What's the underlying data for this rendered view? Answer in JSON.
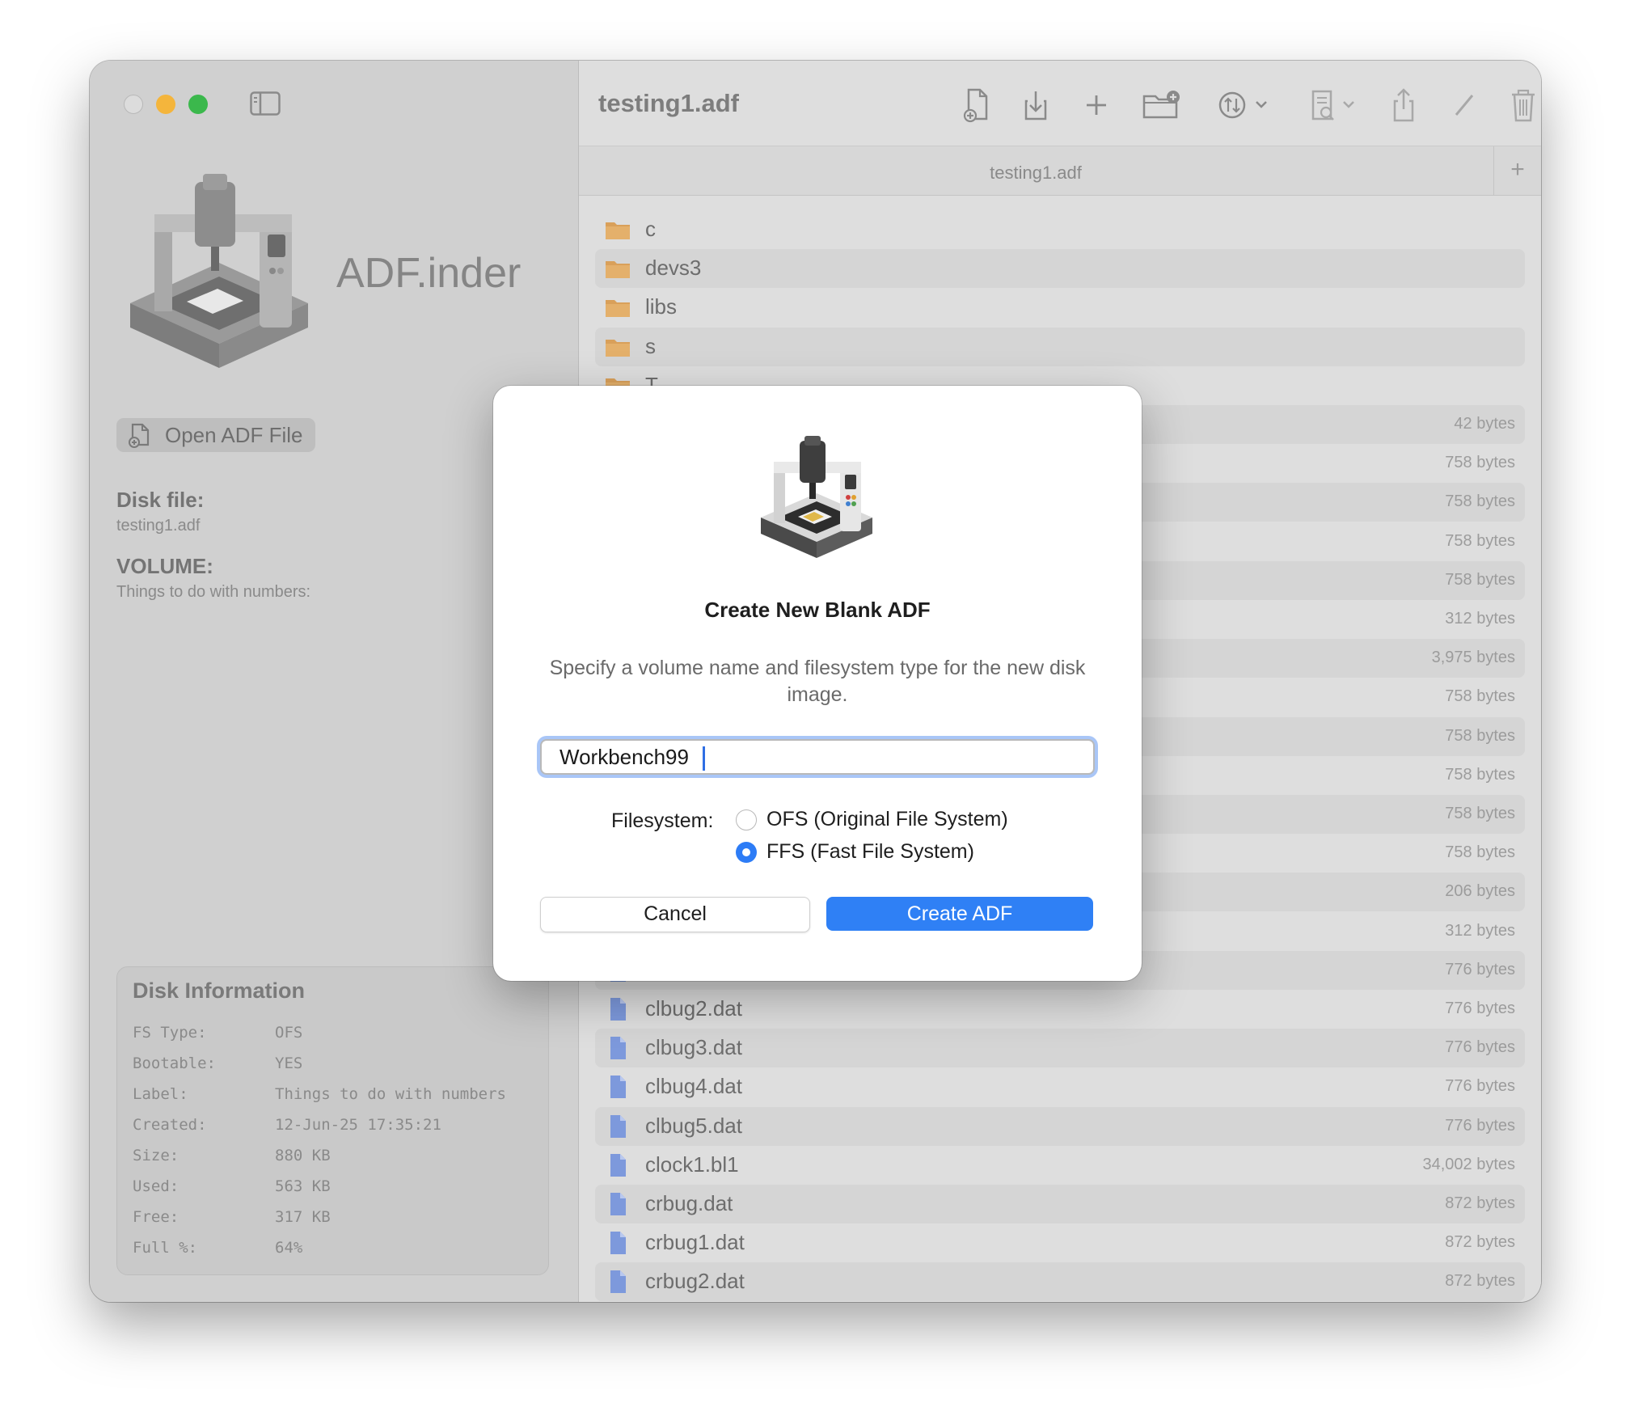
{
  "window": {
    "title": "testing1.adf"
  },
  "sidebar": {
    "app_name": "ADF.inder",
    "open_button": "Open ADF File",
    "disk_file_heading": "Disk file:",
    "disk_file_value": "testing1.adf",
    "volume_heading": "VOLUME:",
    "volume_value": "Things to do with numbers:",
    "disk_info": {
      "title": "Disk Information",
      "rows": [
        {
          "key": "FS Type:",
          "value": "OFS"
        },
        {
          "key": "Bootable:",
          "value": "YES"
        },
        {
          "key": "Label:",
          "value": "Things to do with numbers"
        },
        {
          "key": "Created:",
          "value": "12-Jun-25 17:35:21"
        },
        {
          "key": "Size:",
          "value": "880 KB"
        },
        {
          "key": "Used:",
          "value": "563 KB"
        },
        {
          "key": "Free:",
          "value": "317 KB"
        },
        {
          "key": "Full %:",
          "value": "64%"
        }
      ]
    }
  },
  "toolbar": {
    "icons": [
      "new-document-icon",
      "import-icon",
      "add-icon",
      "new-folder-icon",
      "sort-icon",
      "chevron-down-icon",
      "preview-icon",
      "chevron-down-icon",
      "share-icon",
      "rename-icon",
      "trash-icon",
      "info-icon"
    ]
  },
  "tabs": {
    "active": "testing1.adf",
    "add_label": "+"
  },
  "files": [
    {
      "name": "c",
      "type": "folder",
      "size": ""
    },
    {
      "name": "devs3",
      "type": "folder",
      "size": ""
    },
    {
      "name": "libs",
      "type": "folder",
      "size": ""
    },
    {
      "name": "s",
      "type": "folder",
      "size": ""
    },
    {
      "name": "T",
      "type": "folder",
      "size": ""
    },
    {
      "name": "",
      "type": "file",
      "size": "42 bytes"
    },
    {
      "name": "",
      "type": "file",
      "size": "758 bytes"
    },
    {
      "name": "",
      "type": "file",
      "size": "758 bytes"
    },
    {
      "name": "",
      "type": "file",
      "size": "758 bytes"
    },
    {
      "name": "",
      "type": "file",
      "size": "758 bytes"
    },
    {
      "name": "",
      "type": "file",
      "size": "312 bytes"
    },
    {
      "name": "",
      "type": "file",
      "size": "3,975 bytes"
    },
    {
      "name": "",
      "type": "file",
      "size": "758 bytes"
    },
    {
      "name": "",
      "type": "file",
      "size": "758 bytes"
    },
    {
      "name": "",
      "type": "file",
      "size": "758 bytes"
    },
    {
      "name": "",
      "type": "file",
      "size": "758 bytes"
    },
    {
      "name": "",
      "type": "file",
      "size": "758 bytes"
    },
    {
      "name": "",
      "type": "file",
      "size": "206 bytes"
    },
    {
      "name": "",
      "type": "file",
      "size": "312 bytes"
    },
    {
      "name": "",
      "type": "file",
      "size": "776 bytes"
    },
    {
      "name": "clbug2.dat",
      "type": "file",
      "size": "776 bytes"
    },
    {
      "name": "clbug3.dat",
      "type": "file",
      "size": "776 bytes"
    },
    {
      "name": "clbug4.dat",
      "type": "file",
      "size": "776 bytes"
    },
    {
      "name": "clbug5.dat",
      "type": "file",
      "size": "776 bytes"
    },
    {
      "name": "clock1.bl1",
      "type": "file",
      "size": "34,002 bytes"
    },
    {
      "name": "crbug.dat",
      "type": "file",
      "size": "872 bytes"
    },
    {
      "name": "crbug1.dat",
      "type": "file",
      "size": "872 bytes"
    },
    {
      "name": "crbug2.dat",
      "type": "file",
      "size": "872 bytes"
    }
  ],
  "dialog": {
    "title": "Create New Blank ADF",
    "message": "Specify a volume name and filesystem type for the new disk image.",
    "volume_name_value": "Workbench99",
    "filesystem_label": "Filesystem:",
    "options": [
      {
        "label": "OFS (Original File System)",
        "selected": false
      },
      {
        "label": "FFS (Fast File System)",
        "selected": true
      }
    ],
    "cancel_label": "Cancel",
    "create_label": "Create ADF"
  },
  "colors": {
    "accent": "#2f80f5",
    "folder": "#d9a05a",
    "file": "#6f8fd6",
    "traffic_min": "#f4b53c",
    "traffic_max": "#3bb84c"
  }
}
